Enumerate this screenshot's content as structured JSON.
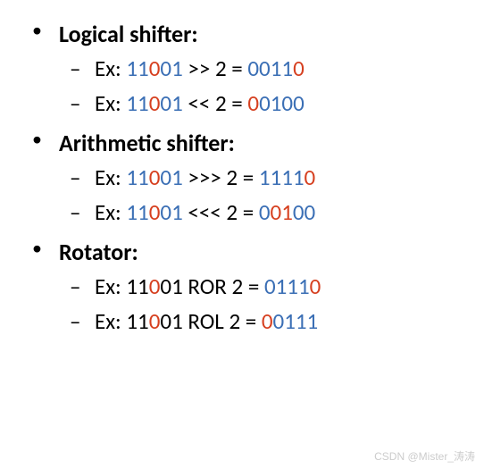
{
  "sections": [
    {
      "heading": "Logical shifter:",
      "examples": [
        {
          "label": "Ex: ",
          "parts": [
            {
              "t": "11",
              "c": "blu"
            },
            {
              "t": "0",
              "c": "red"
            },
            {
              "t": "01",
              "c": "blu"
            },
            {
              "t": " >> 2 = ",
              "c": "blk"
            },
            {
              "t": "00",
              "c": "blu"
            },
            {
              "t": "11",
              "c": "blu"
            },
            {
              "t": "0",
              "c": "red"
            }
          ]
        },
        {
          "label": "Ex: ",
          "parts": [
            {
              "t": "11",
              "c": "blu"
            },
            {
              "t": "0",
              "c": "red"
            },
            {
              "t": "01",
              "c": "blu"
            },
            {
              "t": " << 2 = ",
              "c": "blk"
            },
            {
              "t": "0",
              "c": "red"
            },
            {
              "t": "01",
              "c": "blu"
            },
            {
              "t": "00",
              "c": "blu"
            }
          ]
        }
      ]
    },
    {
      "heading": "Arithmetic shifter:",
      "examples": [
        {
          "label": "Ex: ",
          "parts": [
            {
              "t": "11",
              "c": "blu"
            },
            {
              "t": "0",
              "c": "red"
            },
            {
              "t": "01",
              "c": "blu"
            },
            {
              "t": " >>> 2 = ",
              "c": "blk"
            },
            {
              "t": "11",
              "c": "blu"
            },
            {
              "t": "11",
              "c": "blu"
            },
            {
              "t": "0",
              "c": "red"
            }
          ]
        },
        {
          "label": "Ex: ",
          "parts": [
            {
              "t": "11",
              "c": "blu"
            },
            {
              "t": "0",
              "c": "red"
            },
            {
              "t": "01",
              "c": "blu"
            },
            {
              "t": " <<< 2 = ",
              "c": "blk"
            },
            {
              "t": "0",
              "c": "blu"
            },
            {
              "t": "0",
              "c": "red"
            },
            {
              "t": "1",
              "c": "red"
            },
            {
              "t": "00",
              "c": "blu"
            }
          ]
        }
      ]
    },
    {
      "heading": "Rotator:",
      "examples": [
        {
          "label": "Ex: ",
          "parts": [
            {
              "t": "11",
              "c": "blk"
            },
            {
              "t": "0",
              "c": "red"
            },
            {
              "t": "01",
              "c": "blk"
            },
            {
              "t": " ROR 2 = ",
              "c": "blk"
            },
            {
              "t": "01",
              "c": "blu"
            },
            {
              "t": "11",
              "c": "blu"
            },
            {
              "t": "0",
              "c": "red"
            }
          ]
        },
        {
          "label": "Ex: ",
          "parts": [
            {
              "t": "11",
              "c": "blk"
            },
            {
              "t": "0",
              "c": "red"
            },
            {
              "t": "01",
              "c": "blk"
            },
            {
              "t": " ROL 2 = ",
              "c": "blk"
            },
            {
              "t": "0",
              "c": "red"
            },
            {
              "t": "01",
              "c": "blu"
            },
            {
              "t": "11",
              "c": "blu"
            }
          ]
        }
      ]
    }
  ],
  "watermark": "CSDN @Mister_涛涛"
}
